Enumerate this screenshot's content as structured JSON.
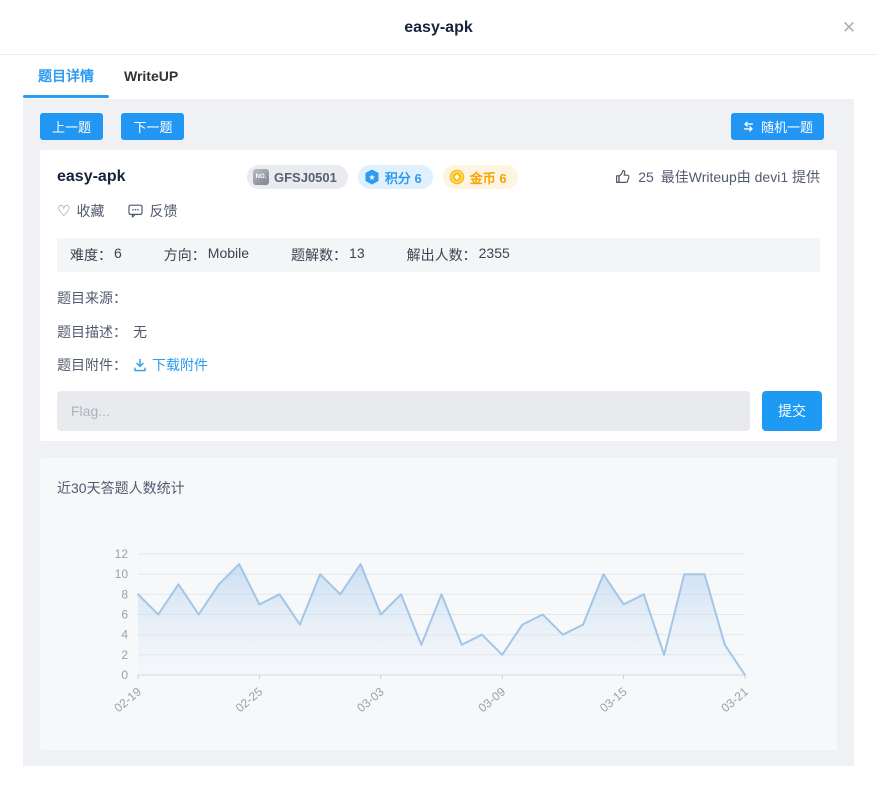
{
  "colors": {
    "accent": "#2196f3",
    "link": "#2d9cf0",
    "line": "#a3c6e8",
    "fill_top": "rgba(168,202,236,0.55)",
    "fill_bottom": "rgba(210,228,245,0.04)"
  },
  "modal": {
    "title": "easy-apk"
  },
  "tabs": [
    {
      "label": "题目详情"
    },
    {
      "label": "WriteUP"
    }
  ],
  "nav": {
    "prev": "上一题",
    "next": "下一题",
    "random": "随机一题"
  },
  "challenge": {
    "name": "easy-apk",
    "id_badge": {
      "icon_label": "NO.",
      "text": "GFSJ0501"
    },
    "score_badge": "积分 6",
    "coin_badge": "金币 6",
    "likes": "25",
    "best_writeup": "最佳Writeup由 devi1 提供",
    "favorite": "收藏",
    "feedback": "反馈",
    "stats": [
      {
        "label": "难度：",
        "value": "6"
      },
      {
        "label": "方向：",
        "value": "Mobile"
      },
      {
        "label": "题解数：",
        "value": "13"
      },
      {
        "label": "解出人数：",
        "value": "2355"
      }
    ],
    "source_label": "题目来源：",
    "source_value": "",
    "desc_label": "题目描述：",
    "desc_value": "无",
    "attach_label": "题目附件：",
    "attach_link": "下载附件",
    "flag_placeholder": "Flag...",
    "submit": "提交"
  },
  "chart_card": {
    "title": "近30天答题人数统计"
  },
  "chart_data": {
    "type": "area",
    "title": "近30天答题人数统计",
    "x": [
      "02-19",
      "02-20",
      "02-21",
      "02-22",
      "02-23",
      "02-24",
      "02-25",
      "02-26",
      "02-27",
      "02-28",
      "03-01",
      "03-02",
      "03-03",
      "03-04",
      "03-05",
      "03-06",
      "03-07",
      "03-08",
      "03-09",
      "03-10",
      "03-11",
      "03-12",
      "03-13",
      "03-14",
      "03-15",
      "03-16",
      "03-17",
      "03-18",
      "03-19",
      "03-20",
      "03-21"
    ],
    "values": [
      8,
      6,
      9,
      6,
      9,
      11,
      7,
      8,
      5,
      10,
      8,
      11,
      6,
      8,
      3,
      8,
      3,
      4,
      2,
      5,
      6,
      4,
      5,
      10,
      7,
      8,
      2,
      10,
      10,
      3,
      0
    ],
    "x_tick_labels": [
      "02-19",
      "02-25",
      "03-03",
      "03-09",
      "03-15",
      "03-21"
    ],
    "ylim": [
      0,
      12
    ],
    "y_ticks": [
      0,
      2,
      4,
      6,
      8,
      10,
      12
    ],
    "grid": true,
    "legend": "none",
    "xlabel": "",
    "ylabel": ""
  }
}
